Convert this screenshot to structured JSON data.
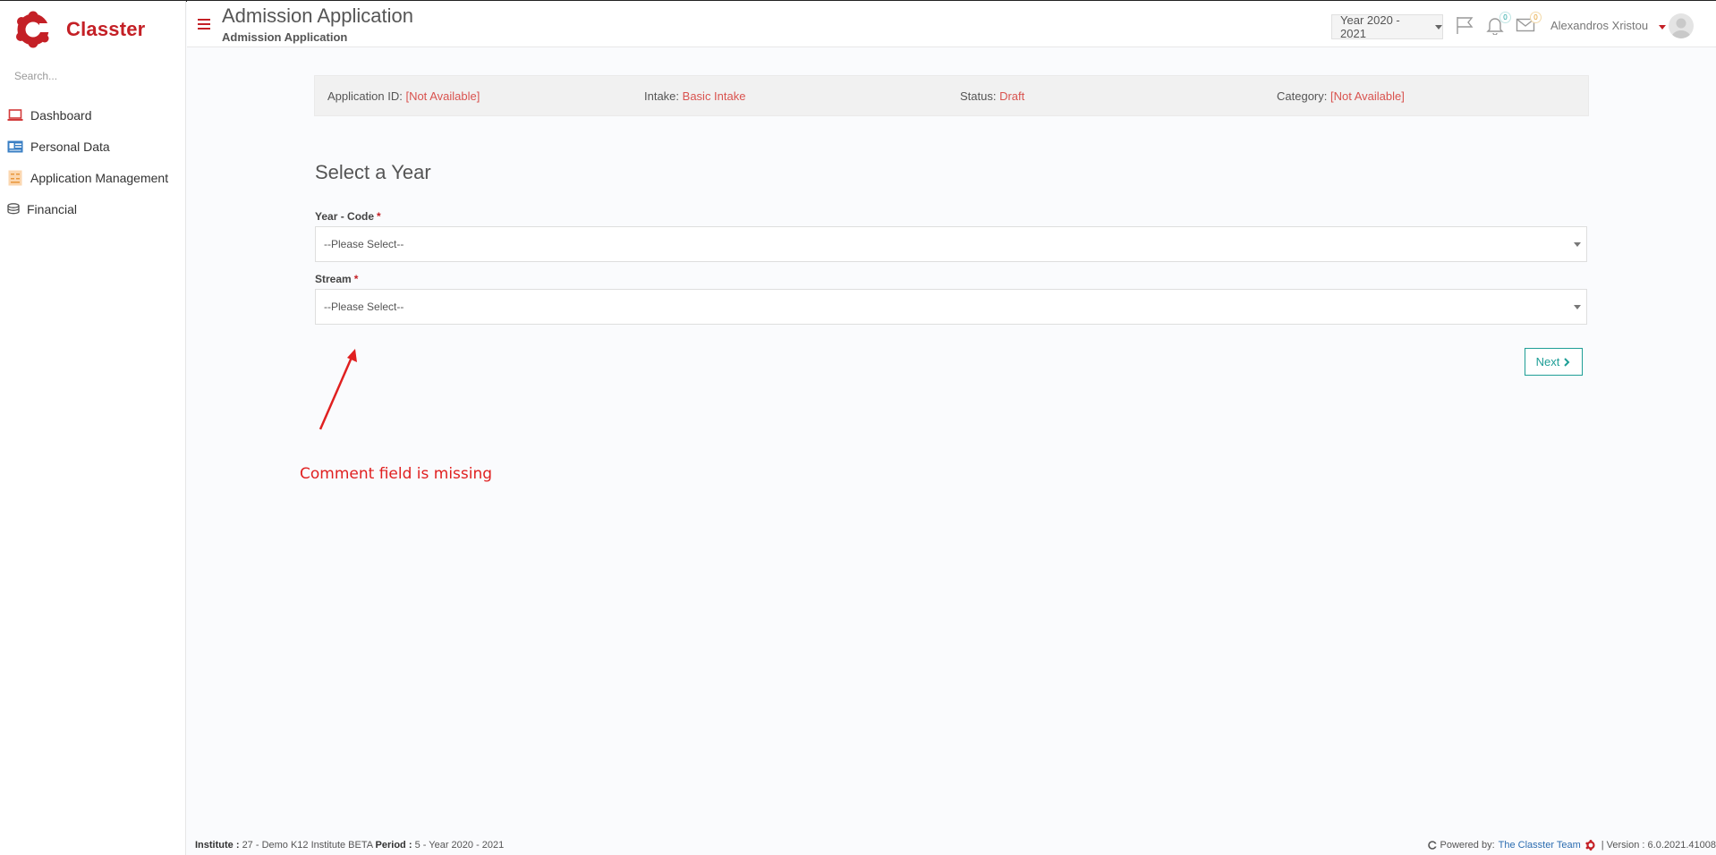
{
  "app": {
    "brand": "Classter",
    "brand_color": "#c42026",
    "logo_icon": "classter-logo-icon"
  },
  "sidebar": {
    "search_placeholder": "Search...",
    "items": [
      {
        "label": "Dashboard",
        "icon": "laptop-icon"
      },
      {
        "label": "Personal Data",
        "icon": "id-card-icon"
      },
      {
        "label": "Application Management",
        "icon": "application-icon"
      },
      {
        "label": "Financial",
        "icon": "coins-icon"
      }
    ]
  },
  "header": {
    "title": "Admission Application",
    "subtitle": "Admission Application",
    "year_select": "Year 2020 - 2021",
    "notifications_count": "0",
    "messages_count": "0",
    "user_name": "Alexandros Xristou"
  },
  "info_bar": {
    "application_id_label": "Application ID:",
    "application_id_value": "[Not Available]",
    "intake_label": "Intake:",
    "intake_value": "Basic Intake",
    "status_label": "Status:",
    "status_value": "Draft",
    "category_label": "Category:",
    "category_value": "[Not Available]"
  },
  "form": {
    "section_title": "Select a Year",
    "year_code_label": "Year - Code",
    "year_code_value": "--Please Select--",
    "stream_label": "Stream",
    "stream_value": "--Please Select--",
    "required_marker": "*",
    "next_label": "Next"
  },
  "annotation": {
    "text": "Comment field is missing",
    "color": "#e02020"
  },
  "footer": {
    "institute_label": "Institute :",
    "institute_value": "27 - Demo K12 Institute BETA",
    "period_label": "Period :",
    "period_value": "5 - Year 2020 - 2021",
    "powered_by": "Powered by:",
    "team": "The Classter Team",
    "version": "| Version : 6.0.2021.41008"
  },
  "colors": {
    "accent_red": "#c42026",
    "value_red": "#d9534f",
    "next_teal": "#1e9e96"
  }
}
